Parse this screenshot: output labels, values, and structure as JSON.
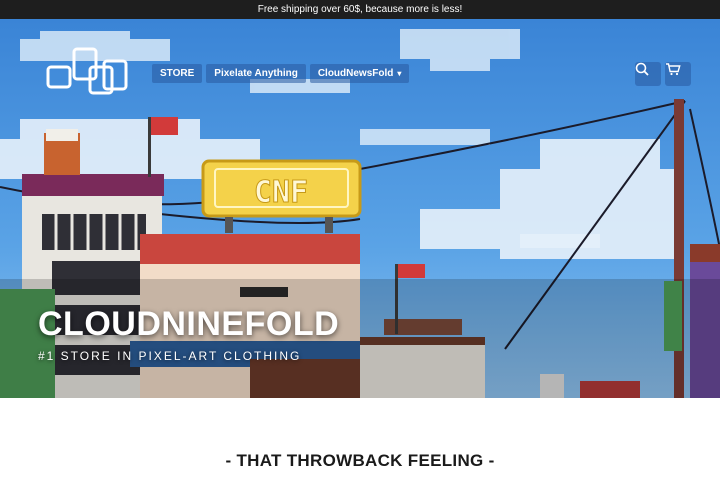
{
  "announcement": "Free shipping over 60$, because more is less!",
  "nav": {
    "items": [
      {
        "label": "STORE"
      },
      {
        "label": "Pixelate Anything"
      },
      {
        "label": "CloudNewsFold",
        "has_dropdown": true
      }
    ]
  },
  "header_icons": [
    "search-icon",
    "cart-icon"
  ],
  "hero": {
    "title": "CLOUDNINEFOLD",
    "subtitle": "#1 STORE IN PIXEL-ART CLOTHING",
    "billboard_text": "CNF",
    "sky_color": "#3f8ddb"
  },
  "section": {
    "title": "- THAT THROWBACK FEELING -"
  }
}
